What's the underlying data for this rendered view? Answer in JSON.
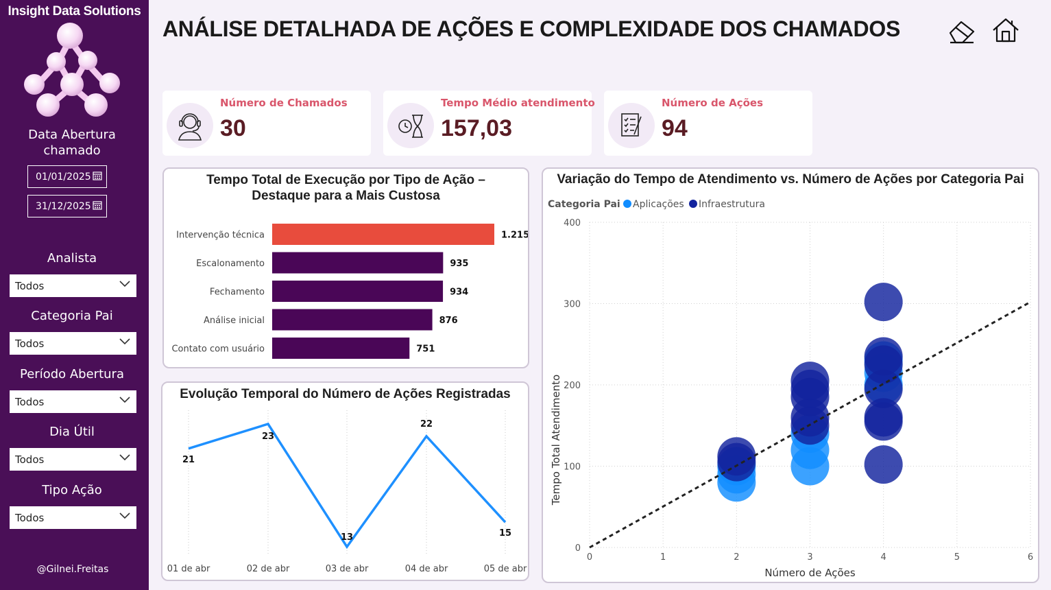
{
  "sidebar": {
    "brand": "Insight Data Solutions",
    "date_title": "Data Abertura chamado",
    "date_start": "01/01/2025",
    "date_end": "31/12/2025",
    "slicers": [
      {
        "label": "Analista",
        "value": "Todos"
      },
      {
        "label": "Categoria Pai",
        "value": "Todos"
      },
      {
        "label": "Período Abertura",
        "value": "Todos"
      },
      {
        "label": "Dia Útil",
        "value": "Todos"
      },
      {
        "label": "Tipo Ação",
        "value": "Todos"
      }
    ],
    "credit": "@Gilnei.Freitas"
  },
  "header": {
    "title": "ANÁLISE DETALHADA DE AÇÕES E COMPLEXIDADE DOS CHAMADOS",
    "icons": [
      "eraser-icon",
      "home-icon"
    ]
  },
  "kpis": [
    {
      "label": "Número de Chamados",
      "value": "30",
      "icon": "support-agent-icon"
    },
    {
      "label": "Tempo Médio atendimento",
      "value": "157,03",
      "icon": "clock-hourglass-icon"
    },
    {
      "label": "Número de Ações",
      "value": "94",
      "icon": "checklist-icon"
    }
  ],
  "colors": {
    "sidebar": "#4a0f57",
    "bar_default": "#4a0657",
    "bar_highlight": "#e84c3d",
    "line": "#1e90ff",
    "aplicacoes": "#118dff",
    "infraestrutura": "#12239e",
    "kpi_label": "#d9566b",
    "kpi_value": "#5a1c24"
  },
  "chart_data": [
    {
      "type": "bar",
      "orientation": "horizontal",
      "title": "Tempo Total de Execução por Tipo de Ação – Destaque para a Mais Custosa",
      "categories": [
        "Intervenção técnica",
        "Escalonamento",
        "Fechamento",
        "Análise inicial",
        "Contato com usuário"
      ],
      "values": [
        1215,
        935,
        934,
        876,
        751
      ],
      "value_labels": [
        "1.215",
        "935",
        "934",
        "876",
        "751"
      ],
      "highlight": "Intervenção técnica"
    },
    {
      "type": "line",
      "title": "Evolução Temporal do Número de Ações Registradas",
      "x": [
        "01 de abr",
        "02 de abr",
        "03 de abr",
        "04 de abr",
        "05 de abr"
      ],
      "values": [
        21,
        23,
        13,
        22,
        15
      ],
      "value_labels": [
        "21",
        "23",
        "13",
        "22",
        "15"
      ]
    },
    {
      "type": "scatter",
      "title": "Variação do Tempo de Atendimento vs. Número de Ações por Categoria Pai",
      "xlabel": "Número de Ações",
      "ylabel": "Tempo Total Atendimento",
      "legend_title": "Categoria Pai",
      "xlim": [
        0,
        6
      ],
      "ylim": [
        0,
        400
      ],
      "xticks": [
        "0",
        "1",
        "2",
        "3",
        "4",
        "5",
        "6"
      ],
      "yticks": [
        "0",
        "100",
        "200",
        "300",
        "400"
      ],
      "series": [
        {
          "name": "Aplicações",
          "points": [
            [
              2,
              80
            ],
            [
              2,
              90
            ],
            [
              2,
              100
            ],
            [
              3,
              100
            ],
            [
              3,
              120
            ],
            [
              3,
              140
            ],
            [
              4,
              200
            ],
            [
              4,
              215
            ],
            [
              4,
              230
            ]
          ]
        },
        {
          "name": "Infraestrutura",
          "points": [
            [
              2,
              105
            ],
            [
              2,
              112
            ],
            [
              3,
              150
            ],
            [
              3,
              160
            ],
            [
              3,
              185
            ],
            [
              3,
              195
            ],
            [
              3,
              205
            ],
            [
              4,
              102
            ],
            [
              4,
              155
            ],
            [
              4,
              160
            ],
            [
              4,
              195
            ],
            [
              4,
              225
            ],
            [
              4,
              235
            ],
            [
              4,
              302
            ]
          ]
        }
      ],
      "trendline": {
        "from": [
          0,
          0
        ],
        "to": [
          6,
          302
        ]
      }
    }
  ]
}
